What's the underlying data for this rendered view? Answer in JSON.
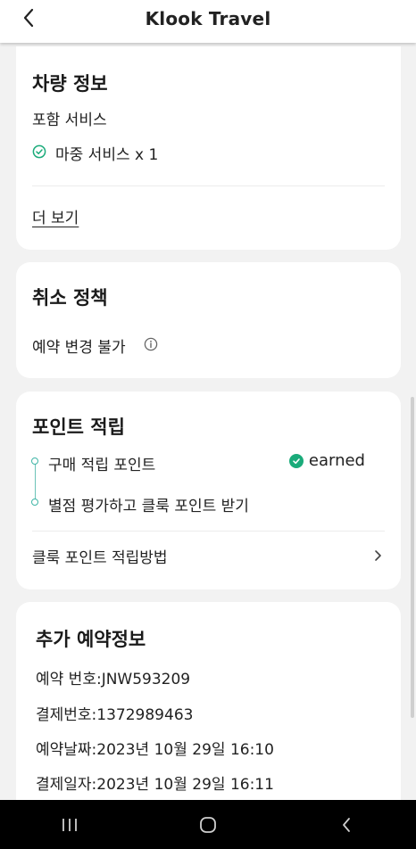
{
  "header": {
    "title": "Klook Travel"
  },
  "vehicle_info": {
    "title": "차량 정보",
    "included_label": "포함 서비스",
    "service_item": "마중 서비스 x 1",
    "more_link": "더 보기"
  },
  "cancel_policy": {
    "title": "취소 정책",
    "policy_text": "예약 변경 불가"
  },
  "points": {
    "title": "포인트 적립",
    "purchase_points": "구매 적립 포인트",
    "earned_label": "earned",
    "review_points": "별점 평가하고 클룩 포인트 받기",
    "how_to_link": "클룩 포인트 적립방법"
  },
  "extra_info": {
    "title": "추가 예약정보",
    "booking_number": "예약 번호:JNW593209",
    "payment_number": "결제번호:1372989463",
    "booking_date": "예약날짜:2023년 10월 29일 16:10",
    "payment_date": "결제일자:2023년 10월 29일 16:11"
  },
  "colors": {
    "accent": "#1aab7a",
    "timeline": "#3fb5a6"
  }
}
